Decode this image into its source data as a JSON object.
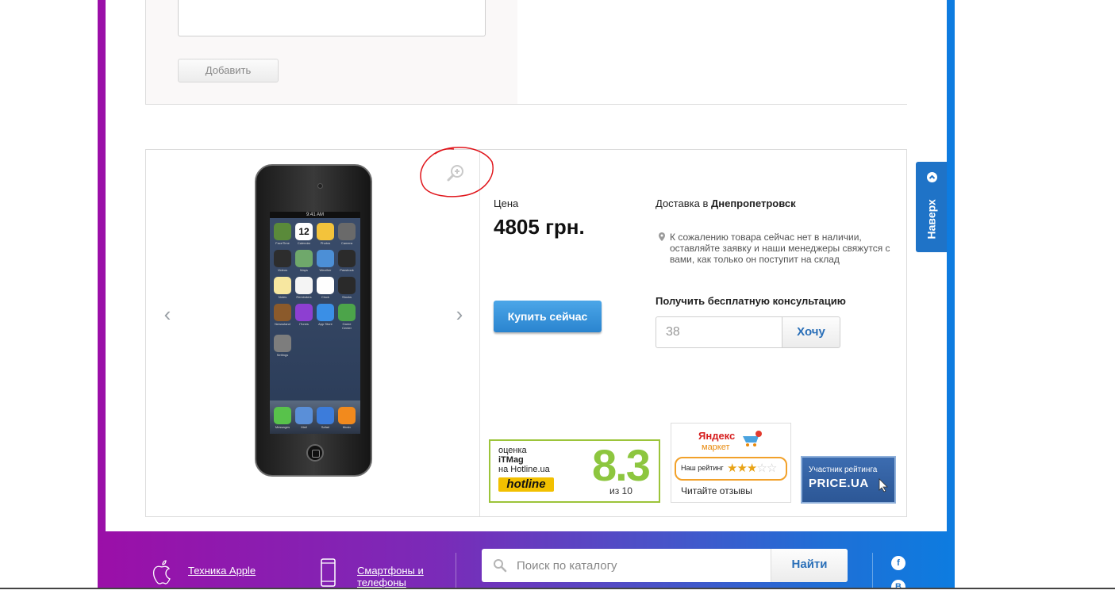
{
  "review": {
    "add_button": "Добавить"
  },
  "product": {
    "price_label": "Цена",
    "price": "4805 грн.",
    "buy_button": "Купить сейчас",
    "delivery_prefix": "Доставка в",
    "delivery_city": "Днепропетровск",
    "notice": "К сожалению товара сейчас нет в наличии, оставляйте заявку и наши менеджеры свяжутся с вами, как только он поступит на склад",
    "consult_label": "Получить бесплатную консультацию",
    "phone_value": "38",
    "want_button": "Хочу"
  },
  "ipod": {
    "status_time": "9:41 AM",
    "apps": [
      "FaceTime",
      "Calendar",
      "Photos",
      "Camera",
      "Videos",
      "Maps",
      "Weather",
      "Passbook",
      "Notes",
      "Reminders",
      "Clock",
      "Stocks",
      "Newsstand",
      "iTunes",
      "App Store",
      "Game Center",
      "Settings"
    ],
    "dock": [
      "Messages",
      "Mail",
      "Safari",
      "Music"
    ],
    "app_colors": [
      "#5a8a3a",
      "#ffffff",
      "#f3c33b",
      "#6a6a6a",
      "#2d2d2d",
      "#6fa86b",
      "#4c8fd6",
      "#2b2b2b",
      "#f7e7a0",
      "#f4f4f4",
      "#fefefe",
      "#2a2a2a",
      "#8b5a2b",
      "#8d3fd1",
      "#3a8fe6",
      "#4ca44a",
      "#7d7d7d"
    ],
    "dock_colors": [
      "#58c24b",
      "#5a8fd8",
      "#3c7cdb",
      "#f28a1d"
    ],
    "calendar_day": "12"
  },
  "badges": {
    "hotline_line1": "оценка",
    "hotline_line2": "iTMag",
    "hotline_line3": "на Hotline.ua",
    "hotline_logo": "hotline",
    "hotline_score": "8.3",
    "hotline_of": "из 10",
    "yandex_title": "Яндекс",
    "yandex_sub": "маркет",
    "yandex_rating_label": "Наш рейтинг",
    "yandex_reviews": "Читайте отзывы",
    "yandex_stars": 3,
    "yandex_stars_total": 5,
    "priceua_line1": "Участник рейтинга",
    "priceua_line2": "PRICE.UA"
  },
  "up_tab": {
    "label": "Наверх"
  },
  "footer": {
    "apple_link": "Техника Apple",
    "phones_link": "Смартфоны и телефоны",
    "search_placeholder": "Поиск по каталогу",
    "search_button": "Найти",
    "social": [
      "f",
      "B"
    ]
  },
  "colors": {
    "accent": "#1f73c7",
    "hotline_green": "#8dc63f",
    "annotation_red": "#e0151b"
  }
}
